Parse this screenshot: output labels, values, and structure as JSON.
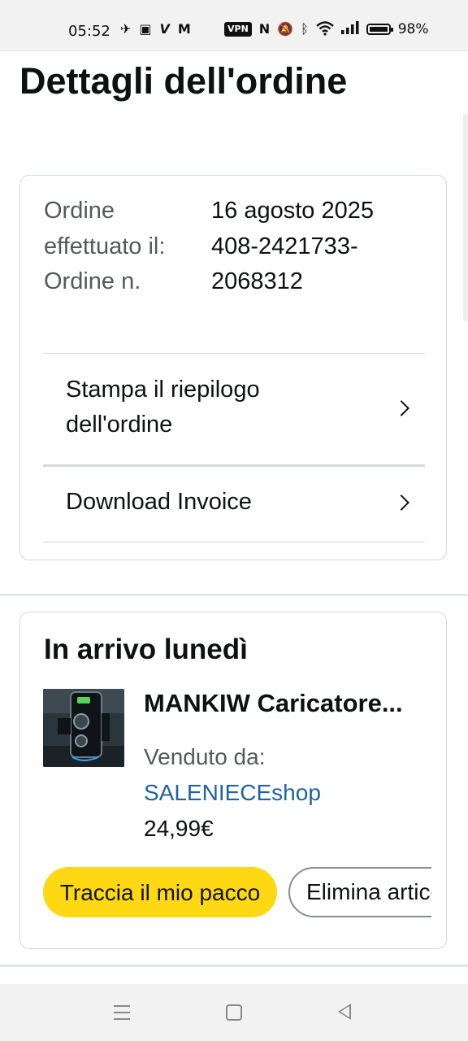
{
  "status_bar": {
    "time": "05:52",
    "vpn_label": "VPN",
    "battery_percent": "98%",
    "icons": [
      "telegram-icon",
      "calendar-icon",
      "v-app-icon",
      "gmail-icon",
      "vpn-icon",
      "nfc-icon",
      "mute-icon",
      "bluetooth-icon",
      "wifi-icon",
      "signal-icon",
      "battery-icon"
    ]
  },
  "page": {
    "title": "Dettagli dell'ordine"
  },
  "order_info": {
    "date_label": "Ordine effettuato il:",
    "date_value": "16 agosto 2025",
    "number_label": "Ordine n.",
    "number_value": "408-2421733-2068312"
  },
  "links": {
    "print_summary": "Stampa il riepilogo dell'ordine",
    "download_invoice": "Download Invoice"
  },
  "shipment": {
    "arrival": "In arrivo lunedì",
    "product_name": "MANKIW Caricatore...",
    "sold_by_label": "Venduto da:",
    "seller": "SALENIECEshop",
    "price": "24,99€",
    "track_button": "Traccia il mio pacco",
    "delete_button": "Elimina articolo"
  },
  "colors": {
    "track_button_bg": "#ffd814",
    "seller_link": "#2162a1"
  }
}
